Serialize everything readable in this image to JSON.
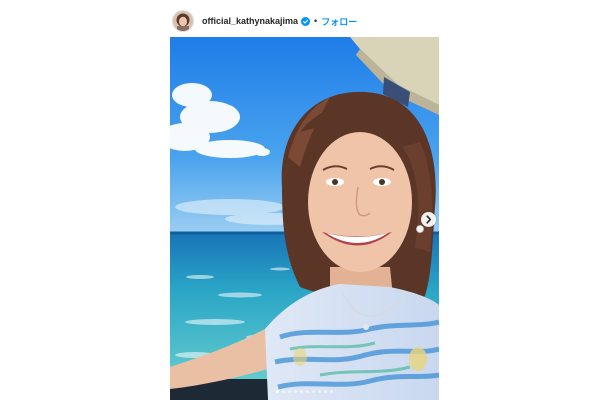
{
  "post": {
    "username": "official_kathynakajima",
    "verified": true,
    "separator": "•",
    "follow_label": "フォロー",
    "carousel": {
      "total_slides": 10,
      "active_index": 0
    },
    "icons": {
      "verified": "verified-badge-icon",
      "next": "chevron-right-icon"
    },
    "colors": {
      "follow": "#0095f6",
      "verified": "#0095f6"
    }
  }
}
